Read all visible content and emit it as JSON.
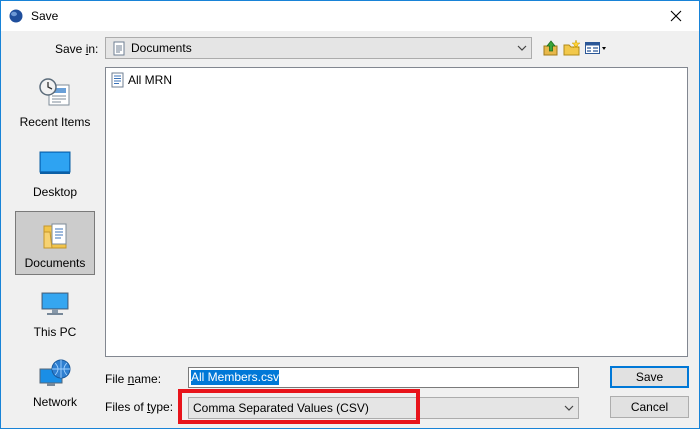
{
  "window": {
    "title": "Save"
  },
  "save_in": {
    "label_pre": "Save ",
    "label_key": "i",
    "label_post": "n:",
    "value": "Documents"
  },
  "places": [
    {
      "label": "Recent Items"
    },
    {
      "label": "Desktop"
    },
    {
      "label": "Documents"
    },
    {
      "label": "This PC"
    },
    {
      "label": "Network"
    }
  ],
  "files": [
    {
      "name": "All MRN"
    }
  ],
  "file_name": {
    "label_pre": "File ",
    "label_key": "n",
    "label_post": "ame:",
    "value": "All Members.csv"
  },
  "file_type": {
    "label_pre": "Files of ",
    "label_key": "t",
    "label_post": "ype:",
    "value": "Comma Separated Values (CSV)"
  },
  "buttons": {
    "save": "Save",
    "cancel": "Cancel"
  },
  "colors": {
    "accent": "#0078d7",
    "highlight": "#e8141b"
  }
}
